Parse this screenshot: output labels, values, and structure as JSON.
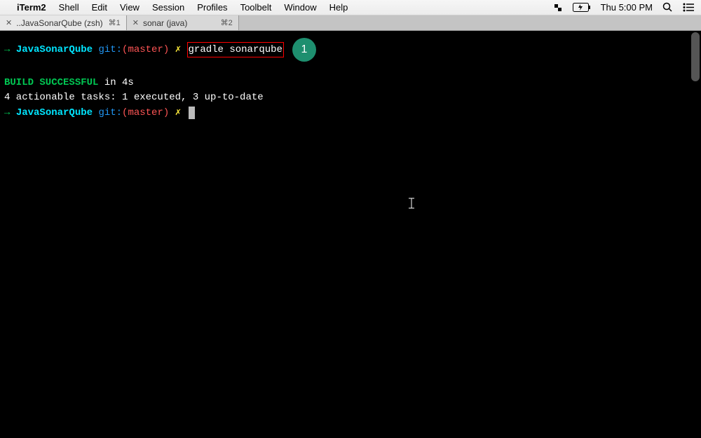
{
  "menubar": {
    "app_name": "iTerm2",
    "items": [
      "Shell",
      "Edit",
      "View",
      "Session",
      "Profiles",
      "Toolbelt",
      "Window",
      "Help"
    ],
    "clock": "Thu 5:00 PM"
  },
  "tabs": [
    {
      "label": "..JavaSonarQube (zsh)",
      "shortcut": "⌘1",
      "active": true
    },
    {
      "label": "sonar (java)",
      "shortcut": "⌘2",
      "active": false
    }
  ],
  "prompt": {
    "arrow": "→",
    "dir": "JavaSonarQube",
    "git_label": "git:",
    "branch": "master",
    "bolt": "✗"
  },
  "command": "gradle sonarqube",
  "annotation": "1",
  "output": {
    "build_success": "BUILD SUCCESSFUL",
    "build_time": " in 4s",
    "tasks_line": "4 actionable tasks: 1 executed, 3 up-to-date"
  }
}
